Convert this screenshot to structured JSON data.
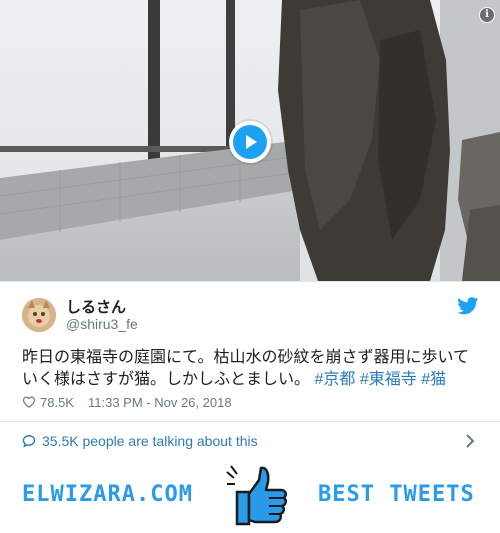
{
  "tweet": {
    "display_name": "しるさん",
    "handle": "@shiru3_fe",
    "text_main": "昨日の東福寺の庭園にて。枯山水の砂紋を崩さず器用に歩いていく様はさすが猫。しかしふとましい。",
    "hashtags": [
      "#京都",
      "#東福寺",
      "#猫"
    ],
    "likes": "78.5K",
    "timestamp": "11:33 PM - Nov 26, 2018"
  },
  "talking": {
    "label": "35.5K people are talking about this"
  },
  "footer": {
    "left_brand": "ELWIZARA.COM",
    "right_brand": "BEST TWEETS"
  },
  "icons": {
    "play": "play-icon",
    "info": "info-icon",
    "bird": "twitter-bird-icon",
    "heart": "heart-icon",
    "bubble": "speech-bubble-icon",
    "chevron": "chevron-right-icon",
    "thumb": "thumbs-up-icon"
  },
  "colors": {
    "accent": "#1da1f2",
    "link": "#2b7bb9",
    "brand": "#2a9be8",
    "muted": "#697882"
  }
}
